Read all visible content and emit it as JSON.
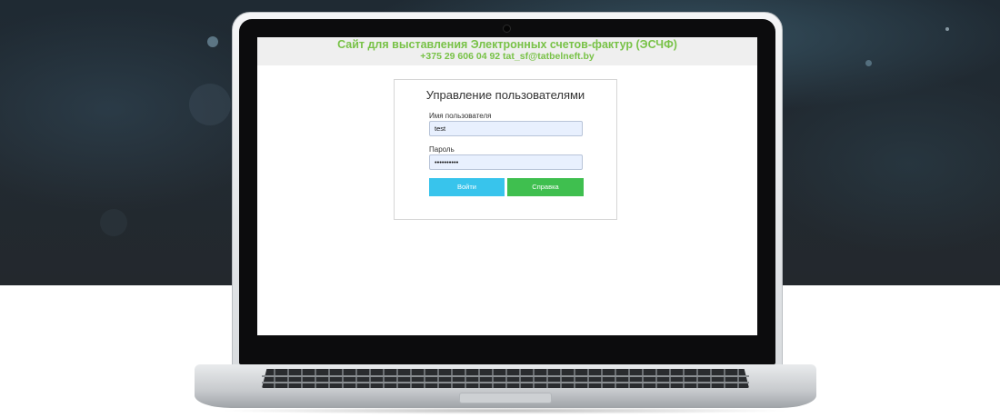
{
  "site": {
    "title": "Сайт для выставления Электронных счетов-фактур (ЭСЧФ)",
    "contacts": "+375 29 606 04 92   tat_sf@tatbelneft.by"
  },
  "login": {
    "title": "Управление пользователями",
    "username_label": "Имя пользователя",
    "username_value": "test",
    "password_label": "Пароль",
    "password_value": "••••••••••",
    "login_button": "Войти",
    "help_button": "Справка"
  },
  "colors": {
    "header_text": "#78c247",
    "login_button": "#38c4ec",
    "help_button": "#3fbf4f",
    "input_background": "#e8f0fe"
  }
}
